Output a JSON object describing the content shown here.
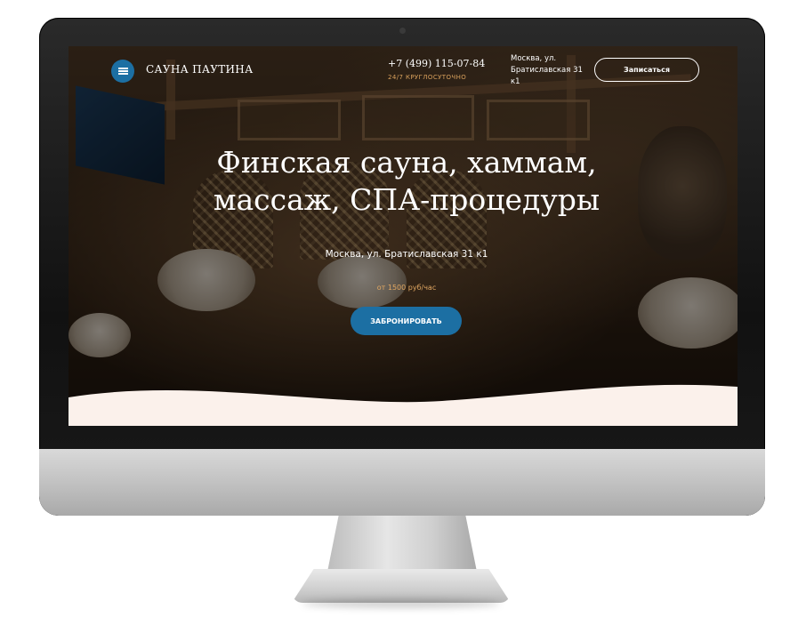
{
  "header": {
    "logo_text": "САУНА ПАУТИНА",
    "phone": "+7 (499) 115-07-84",
    "hours": "24/7 КРУГЛОСУТОЧНО",
    "address_lines": [
      "Москва, ул.",
      "Братиславская 31",
      "к1"
    ],
    "cta_label": "Записаться"
  },
  "hero": {
    "title_lines": [
      "Финская сауна, хаммам,",
      "массаж, СПА-процедуры"
    ],
    "address": "Москва, ул. Братиславская 31 к1",
    "price": "от 1500 руб/час",
    "book_label": "ЗАБРОНИРОВАТЬ"
  },
  "colors": {
    "accent_blue": "#1c6fa3",
    "accent_gold": "#d8a05c",
    "wave_cream": "#fbf1eb"
  },
  "icons": {
    "menu": "hamburger-menu-icon",
    "camera": "camera-icon"
  }
}
